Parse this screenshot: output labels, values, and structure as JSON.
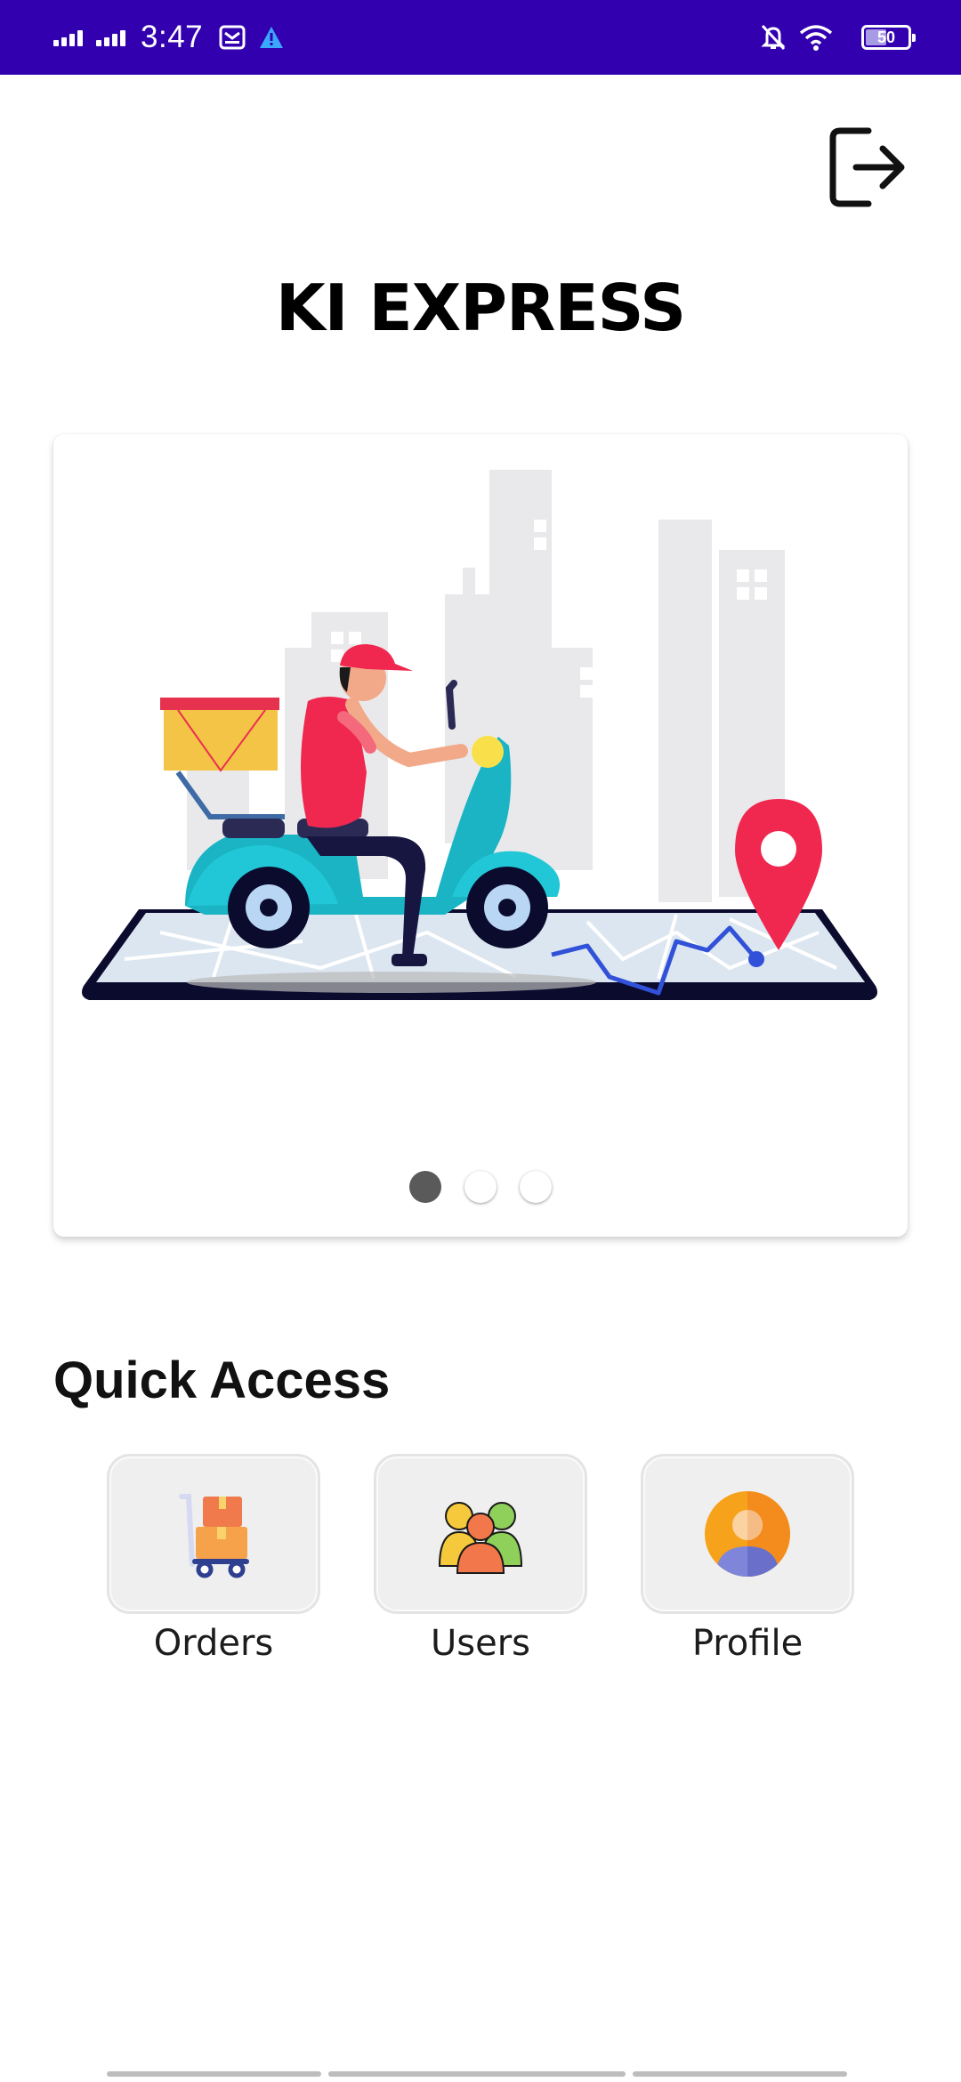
{
  "status_bar": {
    "time": "3:47",
    "battery_level": "50",
    "icons": [
      "signal-icon",
      "signal-icon",
      "email-icon",
      "alert-icon",
      "mute-icon",
      "wifi-icon",
      "battery-icon"
    ]
  },
  "header": {
    "title": "KI EXPRESS",
    "logout_icon": "logout-icon"
  },
  "banner": {
    "illustration": "delivery-scooter-illustration",
    "slides_count": 3,
    "active_slide": 1
  },
  "quick_access": {
    "title": "Quick Access",
    "items": [
      {
        "label": "Orders",
        "icon": "orders-cart-icon"
      },
      {
        "label": "Users",
        "icon": "users-group-icon"
      },
      {
        "label": "Profile",
        "icon": "profile-avatar-icon"
      }
    ]
  },
  "colors": {
    "status_bar": "#3300b0",
    "background": "#ffffff",
    "tile_background": "#efefef",
    "accent_red": "#f0274f",
    "scooter_teal": "#1ab4c4"
  }
}
